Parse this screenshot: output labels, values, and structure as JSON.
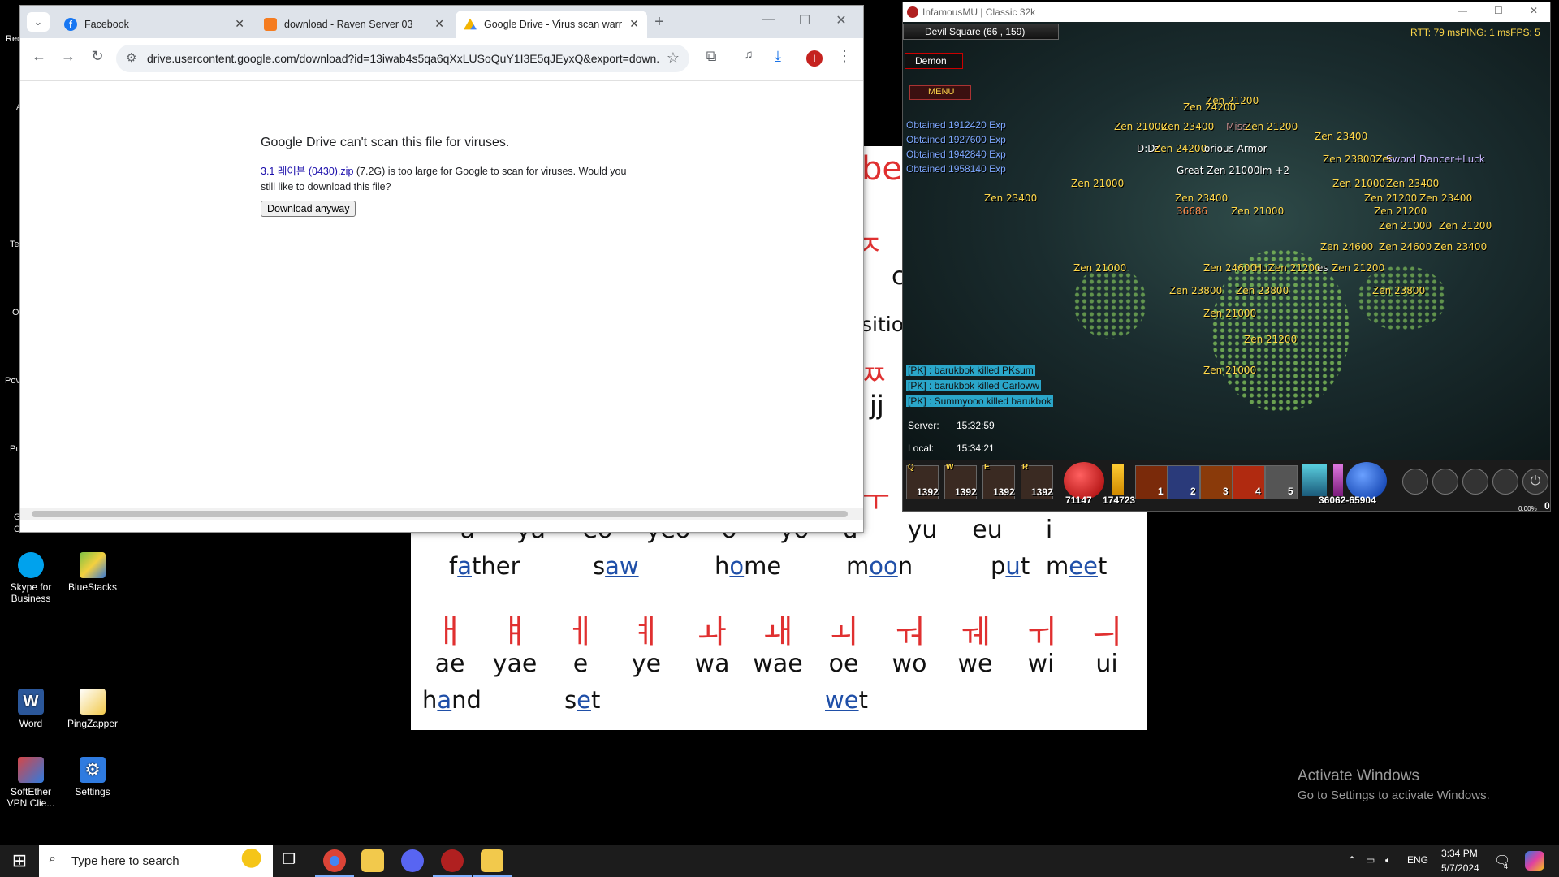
{
  "desktop": {
    "left_edge_labels": [
      "Rec",
      "A",
      "Te",
      "O",
      "Pov",
      "Pu",
      "G",
      "Chrome"
    ],
    "icons": [
      {
        "label": "Skype for Business",
        "color": "#00a2ed"
      },
      {
        "label": "BlueStacks",
        "color": "#7bc043"
      },
      {
        "label": "Word",
        "color": "#2b579a"
      },
      {
        "label": "PingZapper",
        "color": "#f2c94c"
      },
      {
        "label": "SoftEther VPN Clie...",
        "color": "#d64545"
      },
      {
        "label": "Settings",
        "color": "#2f7be0"
      }
    ],
    "watermark": {
      "title": "Activate Windows",
      "subtitle": "Go to Settings to activate Windows."
    }
  },
  "hangul_chart": {
    "partial_texts": [
      "bet",
      "ㅈ",
      "c",
      "sitio",
      "ㅉ",
      "jj",
      "ㅜ"
    ],
    "row1_roman": [
      "a",
      "ya",
      "eo",
      "yeo",
      "o",
      "yo",
      "u",
      "yu",
      "eu",
      "i"
    ],
    "row1_examples": [
      {
        "pre": "f",
        "hl": "a",
        "post": "ther"
      },
      {
        "pre": "s",
        "hl": "aw",
        "post": ""
      },
      {
        "pre": "h",
        "hl": "o",
        "post": "me"
      },
      {
        "pre": "m",
        "hl": "oo",
        "post": "n"
      },
      {
        "pre": "p",
        "hl": "u",
        "post": "t"
      },
      {
        "pre": "m",
        "hl": "ee",
        "post": "t"
      }
    ],
    "row2_hangul": [
      "ㅐ",
      "ㅒ",
      "ㅔ",
      "ㅖ",
      "ㅘ",
      "ㅙ",
      "ㅚ",
      "ㅝ",
      "ㅞ",
      "ㅟ",
      "ㅢ"
    ],
    "row2_roman": [
      "ae",
      "yae",
      "e",
      "ye",
      "wa",
      "wae",
      "oe",
      "wo",
      "we",
      "wi",
      "ui"
    ],
    "row2_examples": [
      {
        "pre": "h",
        "hl": "a",
        "post": "nd"
      },
      {
        "pre": "s",
        "hl": "e",
        "post": "t"
      },
      {
        "pre": "",
        "hl": "we",
        "post": "t"
      }
    ]
  },
  "browser": {
    "tabs": [
      {
        "title": "Facebook",
        "color": "#1877f2",
        "active": false
      },
      {
        "title": "download - Raven Server 03",
        "color": "#f57c20",
        "active": false
      },
      {
        "title": "Google Drive - Virus scan warn",
        "color": "#34a853",
        "active": true
      }
    ],
    "new_tab": "+",
    "url": "drive.usercontent.google.com/download?id=13iwab4s5qa6qXxLUSoQuY1I3E5qJEyxQ&export=down...",
    "page": {
      "heading": "Google Drive can't scan this file for viruses.",
      "filename": "3.1 레이븐 (0430).zip",
      "message_rest": " (7.2G) is too large for Google to scan for viruses. Would you still like to download this file?",
      "button": "Download anyway"
    },
    "profile_initial": "I"
  },
  "game": {
    "title": "InfamousMU | Classic 32k",
    "location": "Devil Square (66 , 159)",
    "stats": "RTT: 79 msPING: 1 msFPS: 5",
    "character": "Demon",
    "menu": "MENU",
    "obtained": [
      "Obtained 1912420 Exp",
      "Obtained 1927600 Exp",
      "Obtained 1942840 Exp",
      "Obtained 1958140 Exp"
    ],
    "pk_log": [
      "[PK] : barukbok killed PKsum",
      "[PK] : barukbok killed Carloww",
      "[PK] : Summyooo killed barukbok"
    ],
    "server_label": "Server:",
    "server_time": "15:32:59",
    "local_label": "Local:",
    "local_time": "15:34:21",
    "floating_texts": [
      "Zen 21200",
      "Zen 24200",
      "Zen 21000",
      "Zen 23400",
      "Miss",
      "Zen 21200",
      "Zen 23400",
      "D:Dz",
      "Zen 24200",
      "orious Armor",
      "Zen 23800Zer",
      "Sword Dancer+Luck",
      "Great Zen 21000lm +2",
      "Zen 21000",
      "Zen 21000",
      "Zen 23400",
      "Zen 23400",
      "Zen 23400",
      "36686",
      "Zen 21000",
      "Zen 21200",
      "Zen 23400",
      "Zen 21200",
      "Zen 21000",
      "Zen 21200",
      "Zen 24600",
      "Zen 24600",
      "Zen 23400",
      "Zen 21000",
      "Zen 24600",
      "HuZen 21200",
      "es",
      "Zen 21200",
      "Zen 23800",
      "Zen 23800",
      "Zen 23800",
      "Zen 21000",
      "Zen 21200",
      "Zen 21000"
    ],
    "hotkeys": [
      {
        "key": "Q",
        "count": "1392"
      },
      {
        "key": "W",
        "count": "1392"
      },
      {
        "key": "E",
        "count": "1392"
      },
      {
        "key": "R",
        "count": "1392"
      }
    ],
    "hp": "71147",
    "mana": "174723",
    "skill_nums": [
      "1",
      "2",
      "3",
      "4",
      "5"
    ],
    "sd": "36062",
    "sd_max": "65904",
    "exp_pct": "0.00%",
    "level_suffix": "0"
  },
  "taskbar": {
    "search_placeholder": "Type here to search",
    "lang": "ENG",
    "time": "3:34 PM",
    "date": "5/7/2024",
    "notif_count": "4"
  }
}
